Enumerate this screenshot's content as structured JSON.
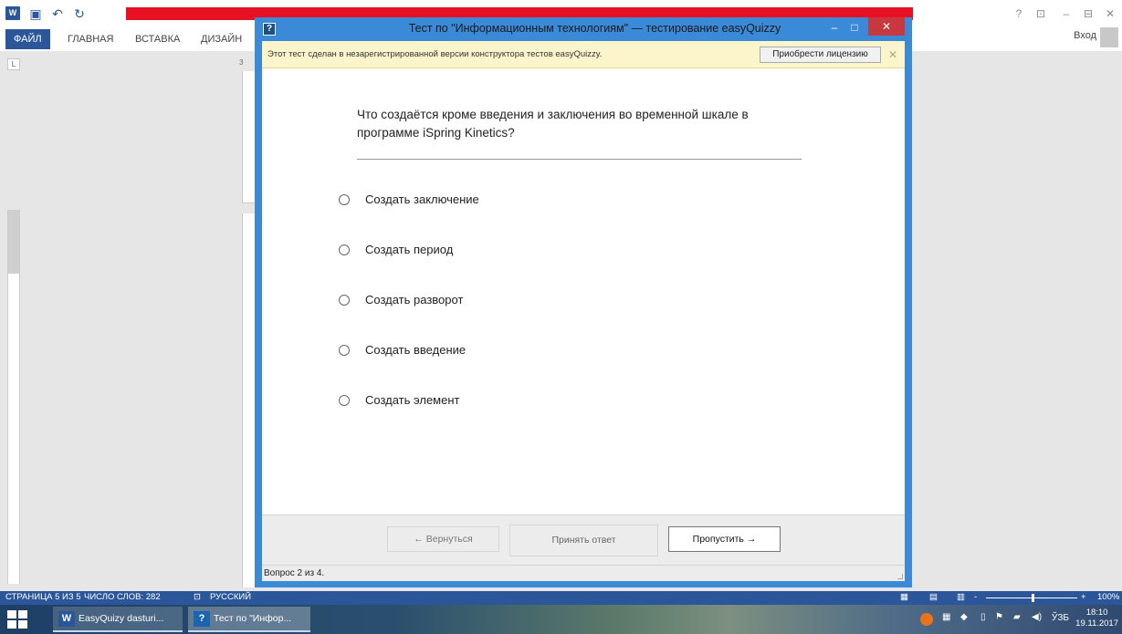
{
  "word": {
    "ribbon_tabs": [
      "ФАЙЛ",
      "ГЛАВНАЯ",
      "ВСТАВКА",
      "ДИЗАЙН"
    ],
    "login": "Вход",
    "ruler_corner": "L",
    "hruler_label": "3",
    "title_controls": [
      "?",
      "⊡",
      "–",
      "⊟",
      "✕"
    ],
    "quick_access_icons": [
      "save-icon",
      "undo-icon",
      "redo-icon"
    ],
    "status": {
      "page": "СТРАНИЦА 5 ИЗ 5",
      "words": "ЧИСЛО СЛОВ: 282",
      "language": "РУССКИЙ",
      "zoom": "100%",
      "zoom_minus": "-",
      "zoom_plus": "+"
    }
  },
  "taskbar": {
    "items": [
      {
        "label": "EasyQuizy dasturi...",
        "icon": "W"
      },
      {
        "label": "Тест по \"Инфор...",
        "icon": "?"
      }
    ],
    "keyboard_lang": "ЎЗБ",
    "time": "18:10",
    "date": "19.11.2017"
  },
  "dialog": {
    "title": "Тест по \"Информационным технологиям\" — тестирование easyQuizzy",
    "icon": "?",
    "notice": "Этот тест сделан в незарегистрированной версии конструктора тестов easyQuizzy.",
    "license_button": "Приобрести лицензию",
    "question": "Что создаётся кроме введения и заключения во временной шкале в программе iSpring Kinetics?",
    "answers": [
      "Создать заключение",
      "Создать период",
      "Создать разворот",
      "Создать введение",
      "Создать элемент"
    ],
    "buttons": {
      "back": "← Вернуться",
      "accept": "Принять ответ",
      "skip": "Пропустить →"
    },
    "progress": "Вопрос 2 из 4."
  }
}
